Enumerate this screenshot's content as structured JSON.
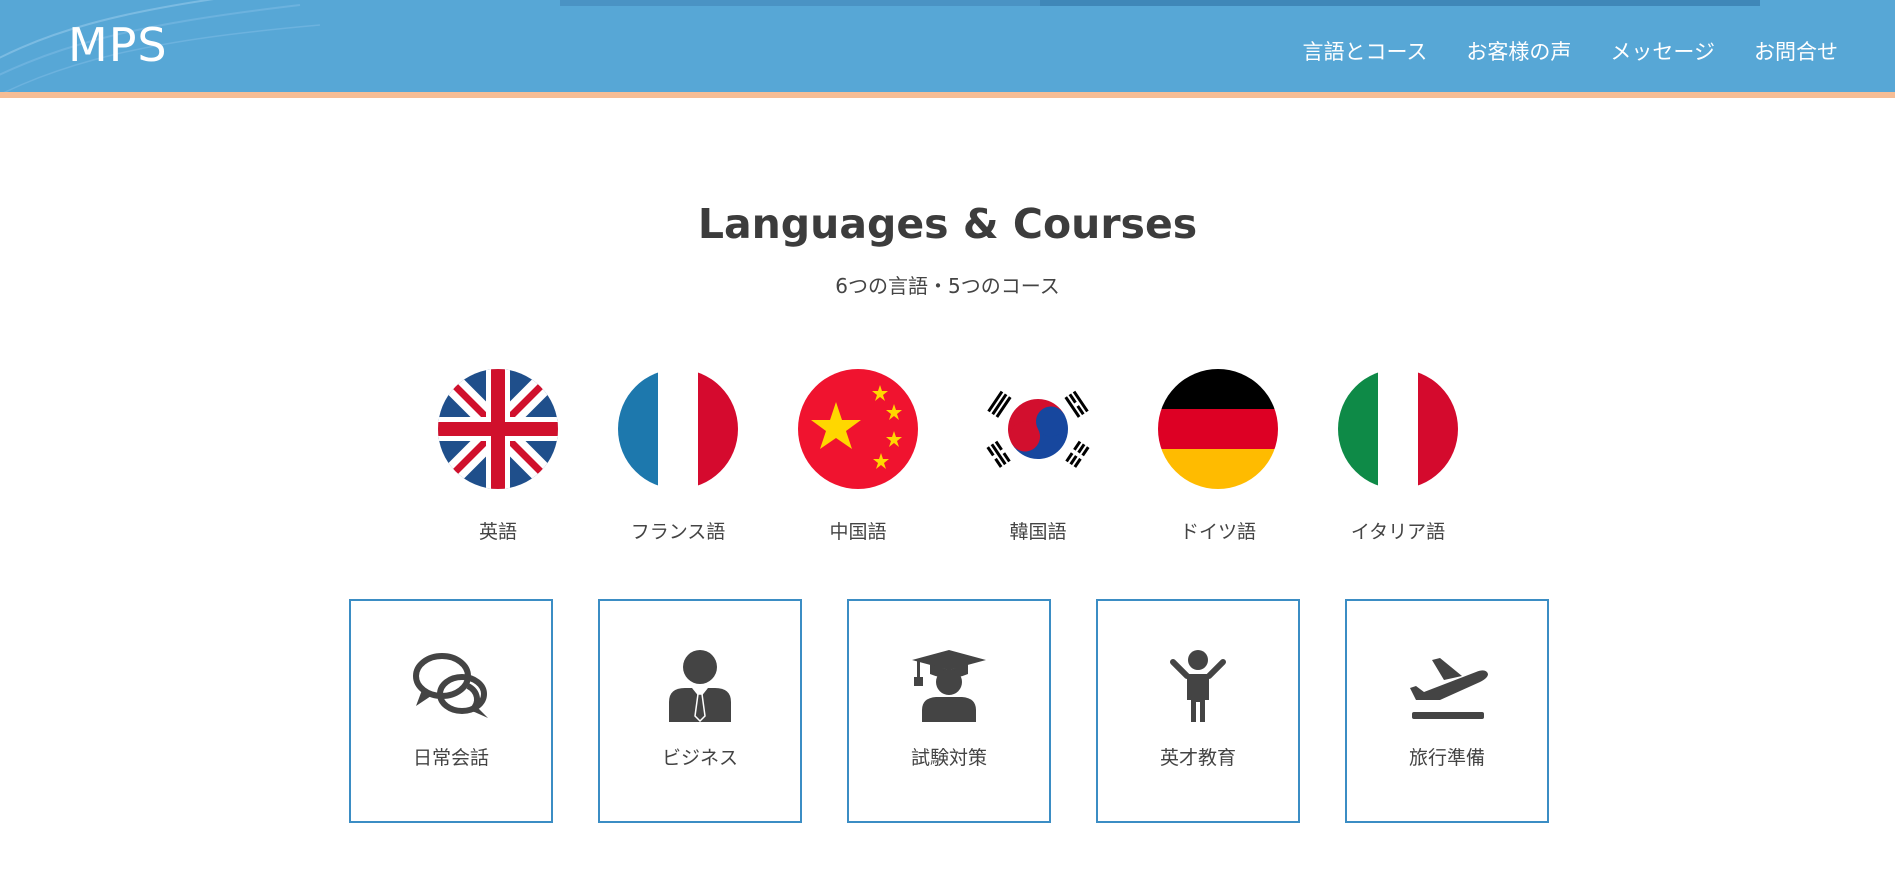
{
  "header": {
    "logo": "MPS",
    "nav": [
      "言語とコース",
      "お客様の声",
      "メッセージ",
      "お問合せ"
    ]
  },
  "section": {
    "title": "Languages & Courses",
    "subtitle": "6つの言語・5つのコース"
  },
  "languages": [
    {
      "label": "英語",
      "icon": "uk-flag-icon"
    },
    {
      "label": "フランス語",
      "icon": "france-flag-icon"
    },
    {
      "label": "中国語",
      "icon": "china-flag-icon"
    },
    {
      "label": "韓国語",
      "icon": "korea-flag-icon"
    },
    {
      "label": "ドイツ語",
      "icon": "germany-flag-icon"
    },
    {
      "label": "イタリア語",
      "icon": "italy-flag-icon"
    }
  ],
  "courses": [
    {
      "label": "日常会話",
      "icon": "chat-bubbles-icon"
    },
    {
      "label": "ビジネス",
      "icon": "businessman-icon"
    },
    {
      "label": "試験対策",
      "icon": "graduate-icon"
    },
    {
      "label": "英才教育",
      "icon": "child-icon"
    },
    {
      "label": "旅行準備",
      "icon": "airplane-takeoff-icon"
    }
  ],
  "colors": {
    "header_bg": "#57a7d6",
    "header_border": "#f6bd95",
    "course_border": "#3b8dc4",
    "text": "#444444"
  }
}
